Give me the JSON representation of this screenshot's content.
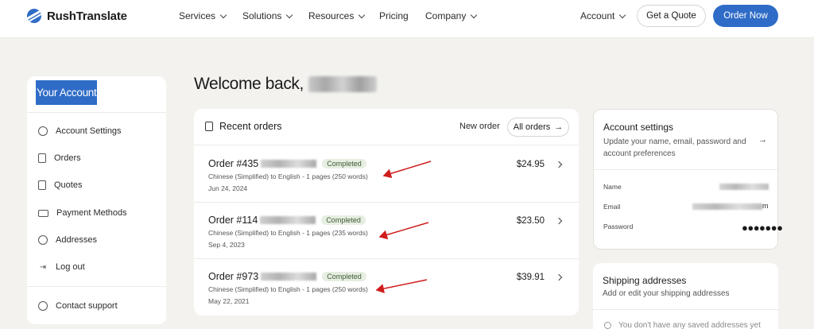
{
  "brand": {
    "name": "RushTranslate"
  },
  "nav": {
    "items": [
      "Services",
      "Solutions",
      "Resources",
      "Pricing",
      "Company"
    ],
    "account": "Account",
    "quote_button": "Get a Quote",
    "order_button": "Order Now"
  },
  "sidebar": {
    "title": "Your Account",
    "items": [
      "Account Settings",
      "Orders",
      "Quotes",
      "Payment Methods",
      "Addresses",
      "Log out"
    ],
    "support": "Contact support"
  },
  "welcome": "Welcome back,",
  "orders": {
    "title": "Recent orders",
    "new_order": "New order",
    "all_orders": "All orders",
    "rows": [
      {
        "id_prefix": "Order #435",
        "status": "Completed",
        "desc": "Chinese (Simplified) to English - 1 pages (250 words)",
        "date": "Jun 24, 2024",
        "price": "$24.95"
      },
      {
        "id_prefix": "Order #114",
        "status": "Completed",
        "desc": "Chinese (Simplified) to English - 1 pages (235 words)",
        "date": "Sep 4, 2023",
        "price": "$23.50"
      },
      {
        "id_prefix": "Order #973",
        "status": "Completed",
        "desc": "Chinese (Simplified) to English - 1 pages (250 words)",
        "date": "May 22, 2021",
        "price": "$39.91"
      }
    ]
  },
  "settings": {
    "title": "Account settings",
    "desc": "Update your name, email, password and account preferences",
    "name_label": "Name",
    "email_label": "Email",
    "email_end": "m",
    "password_label": "Password",
    "password_mask": "●●●●●●●"
  },
  "shipping": {
    "title": "Shipping addresses",
    "desc": "Add or edit your shipping addresses",
    "empty": "You don't have any saved addresses yet"
  },
  "colors": {
    "accent": "#2f6cc7",
    "annotation": "#d01c1c",
    "status_bg": "#e6eee2"
  }
}
